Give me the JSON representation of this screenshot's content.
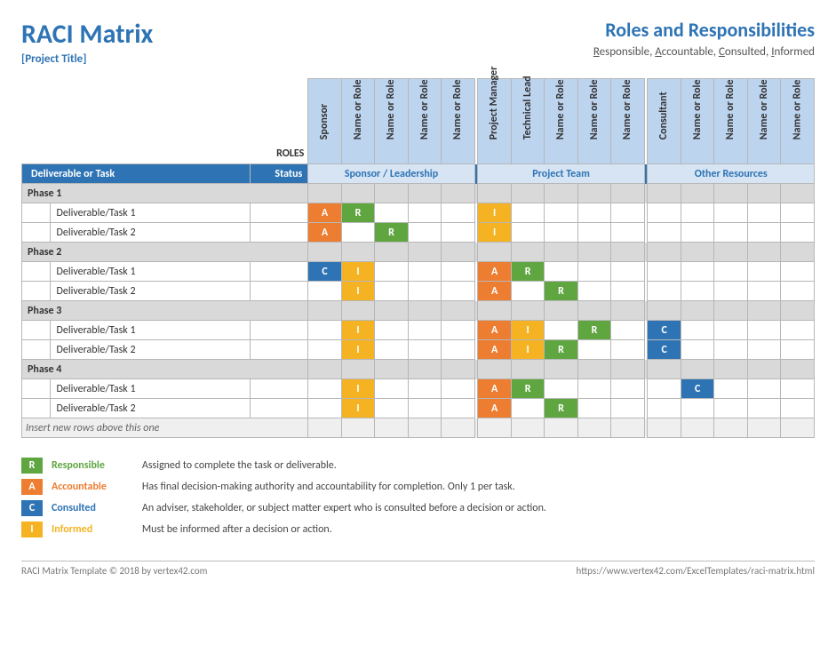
{
  "header": {
    "title": "RACI Matrix",
    "subtitle": "[Project Title]",
    "heading_right": "Roles and Responsibilities",
    "legend_letters": {
      "r": "R",
      "a": "A",
      "c": "C",
      "i": "I"
    },
    "legend_words": {
      "r": "esponsible, ",
      "a": "ccountable, ",
      "c": "onsulted, ",
      "i": "nformed"
    }
  },
  "roles_label": "ROLES",
  "role_groups": [
    {
      "label": "Sponsor / Leadership",
      "roles": [
        "Sponsor",
        "Name or Role",
        "Name or Role",
        "Name or Role",
        "Name or Role"
      ]
    },
    {
      "label": "Project Team",
      "roles": [
        "Project Manager",
        "Technical Lead",
        "Name or Role",
        "Name or Role",
        "Name or Role"
      ]
    },
    {
      "label": "Other Resources",
      "roles": [
        "Consultant",
        "Name or Role",
        "Name or Role",
        "Name or Role",
        "Name or Role"
      ]
    }
  ],
  "columns": {
    "task": "Deliverable or Task",
    "status": "Status"
  },
  "phases": [
    {
      "name": "Phase 1",
      "tasks": [
        {
          "name": "Deliverable/Task 1",
          "cells": [
            "A",
            "R",
            "",
            "",
            "",
            "",
            "I",
            "",
            "",
            "",
            "",
            "",
            "",
            "",
            "",
            "",
            ""
          ]
        },
        {
          "name": "Deliverable/Task 2",
          "cells": [
            "A",
            "",
            "R",
            "",
            "",
            "",
            "I",
            "",
            "",
            "",
            "",
            "",
            "",
            "",
            "",
            "",
            ""
          ]
        }
      ]
    },
    {
      "name": "Phase 2",
      "tasks": [
        {
          "name": "Deliverable/Task 1",
          "cells": [
            "C",
            "I",
            "",
            "",
            "",
            "",
            "A",
            "R",
            "",
            "",
            "",
            "",
            "",
            "",
            "",
            "",
            ""
          ]
        },
        {
          "name": "Deliverable/Task 2",
          "cells": [
            "",
            "I",
            "",
            "",
            "",
            "",
            "A",
            "",
            "R",
            "",
            "",
            "",
            "",
            "",
            "",
            "",
            ""
          ]
        }
      ]
    },
    {
      "name": "Phase 3",
      "tasks": [
        {
          "name": "Deliverable/Task 1",
          "cells": [
            "",
            "I",
            "",
            "",
            "",
            "",
            "A",
            "I",
            "",
            "R",
            "",
            "",
            "C",
            "",
            "",
            "",
            ""
          ]
        },
        {
          "name": "Deliverable/Task 2",
          "cells": [
            "",
            "I",
            "",
            "",
            "",
            "",
            "A",
            "I",
            "R",
            "",
            "",
            "",
            "C",
            "",
            "",
            "",
            ""
          ]
        }
      ]
    },
    {
      "name": "Phase 4",
      "tasks": [
        {
          "name": "Deliverable/Task 1",
          "cells": [
            "",
            "I",
            "",
            "",
            "",
            "",
            "A",
            "R",
            "",
            "",
            "",
            "",
            "",
            "C",
            "",
            "",
            ""
          ]
        },
        {
          "name": "Deliverable/Task 2",
          "cells": [
            "",
            "I",
            "",
            "",
            "",
            "",
            "A",
            "",
            "R",
            "",
            "",
            "",
            "",
            "",
            "",
            "",
            ""
          ]
        }
      ]
    }
  ],
  "insert_hint": "Insert new rows above this one",
  "legend": [
    {
      "code": "R",
      "label": "Responsible",
      "desc": "Assigned to complete the task or deliverable."
    },
    {
      "code": "A",
      "label": "Accountable",
      "desc": "Has final decision-making authority and accountability for completion. Only 1 per task."
    },
    {
      "code": "C",
      "label": "Consulted",
      "desc": "An adviser, stakeholder, or subject matter expert who is consulted before a decision or action."
    },
    {
      "code": "I",
      "label": "Informed",
      "desc": "Must be informed after a decision or action."
    }
  ],
  "footer": {
    "left": "RACI Matrix Template © 2018 by vertex42.com",
    "right": "https://www.vertex42.com/ExcelTemplates/raci-matrix.html"
  }
}
